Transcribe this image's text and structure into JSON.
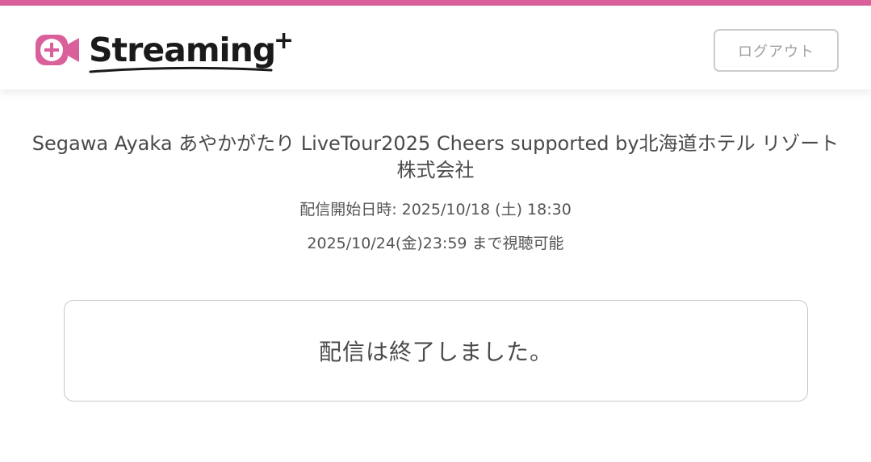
{
  "header": {
    "logo_text": "Streaming",
    "logo_plus": "+",
    "logout_label": "ログアウト"
  },
  "event": {
    "title": "Segawa Ayaka あやかがたり LiveTour2025 Cheers supported by北海道ホテル リゾート株式会社",
    "start_datetime": "配信開始日時: 2025/10/18 (土) 18:30",
    "available_until": "2025/10/24(金)23:59 まで視聴可能"
  },
  "status": {
    "message": "配信は終了しました。"
  },
  "colors": {
    "brand_pink": "#d9609b",
    "text": "#4a4a4a",
    "border": "#c8c8c8"
  },
  "icons": {
    "logo_mark": "camera-plus-icon"
  }
}
